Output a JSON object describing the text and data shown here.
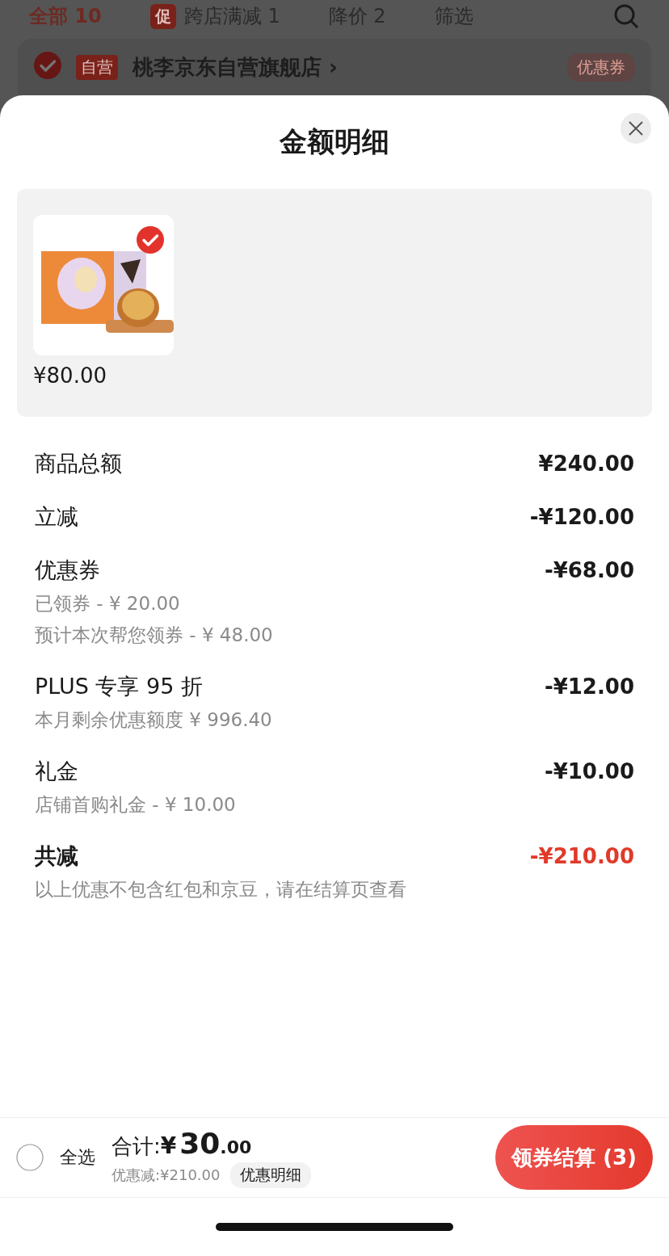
{
  "background": {
    "tabs": [
      {
        "label": "全部 10",
        "selected": true
      },
      {
        "label": "跨店满减 1",
        "selected": false,
        "badge": "促"
      },
      {
        "label": "降价 2",
        "selected": false
      },
      {
        "label": "筛选",
        "selected": false
      }
    ],
    "store": {
      "checked": true,
      "tag": "自营",
      "name": "桃李京东自营旗舰店 ›",
      "coupon": "优惠券"
    }
  },
  "sheet": {
    "title": "金额明细",
    "products": [
      {
        "selected": true,
        "price": "¥80.00"
      }
    ],
    "rows": [
      {
        "kind": "normal",
        "label": "商品总额",
        "amount": "¥240.00",
        "notes": []
      },
      {
        "kind": "normal",
        "label": "立减",
        "amount": "-¥120.00",
        "notes": []
      },
      {
        "kind": "normal",
        "label": "优惠券",
        "amount": "-¥68.00",
        "notes": [
          "已领券 - ¥ 20.00",
          "预计本次帮您领券 - ¥ 48.00"
        ]
      },
      {
        "kind": "normal",
        "label": "PLUS 专享 95 折",
        "amount": "-¥12.00",
        "notes": [
          "本月剩余优惠额度 ¥ 996.40"
        ]
      },
      {
        "kind": "normal",
        "label": "礼金",
        "amount": "-¥10.00",
        "notes": [
          "店铺首购礼金 - ¥ 10.00"
        ]
      },
      {
        "kind": "total",
        "label": "共减",
        "amount": "-¥210.00",
        "notes": [
          "以上优惠不包含红包和京豆，请在结算页查看"
        ]
      }
    ]
  },
  "footer": {
    "select_all": {
      "label": "全选",
      "checked": false
    },
    "total_label": "合计:",
    "currency": "¥",
    "total_int": "30",
    "total_dec": ".00",
    "discount": "优惠减:¥210.00",
    "detail_button": "优惠明细",
    "checkout_button": "领券结算 (3)"
  }
}
